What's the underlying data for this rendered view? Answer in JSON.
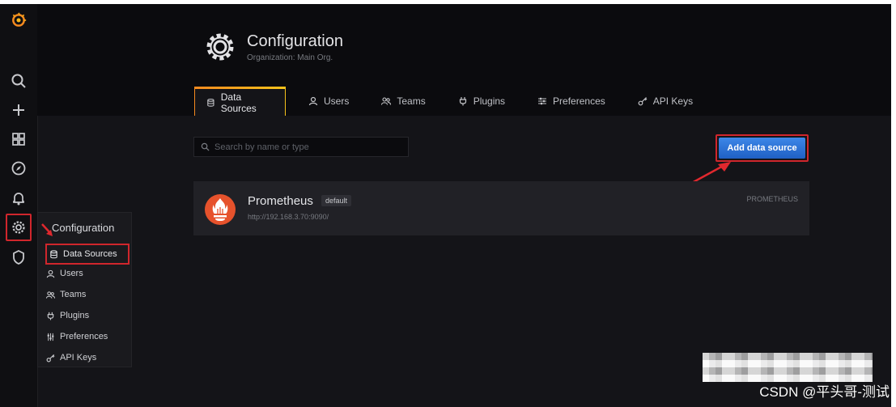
{
  "header": {
    "title": "Configuration",
    "subtitle": "Organization: Main Org."
  },
  "tabs": [
    {
      "label": "Data Sources",
      "icon": "database-icon",
      "active": true
    },
    {
      "label": "Users",
      "icon": "user-icon"
    },
    {
      "label": "Teams",
      "icon": "users-icon"
    },
    {
      "label": "Plugins",
      "icon": "plug-icon"
    },
    {
      "label": "Preferences",
      "icon": "sliders-icon"
    },
    {
      "label": "API Keys",
      "icon": "key-icon"
    }
  ],
  "search": {
    "placeholder": "Search by name or type",
    "value": ""
  },
  "toolbar": {
    "add_label": "Add data source"
  },
  "datasource": {
    "name": "Prometheus",
    "badge": "default",
    "url": "http://192.168.3.70:9090/",
    "type": "PROMETHEUS"
  },
  "flyout": {
    "title": "Configuration",
    "items": [
      {
        "label": "Data Sources",
        "icon": "database-icon"
      },
      {
        "label": "Users",
        "icon": "user-icon"
      },
      {
        "label": "Teams",
        "icon": "users-icon"
      },
      {
        "label": "Plugins",
        "icon": "plug-icon"
      },
      {
        "label": "Preferences",
        "icon": "sliders-icon"
      },
      {
        "label": "API Keys",
        "icon": "key-icon"
      }
    ]
  },
  "sidebar": {
    "icons": [
      "grafana-logo-icon",
      "search-icon",
      "plus-icon",
      "dashboards-icon",
      "compass-icon",
      "bell-icon",
      "gear-icon",
      "shield-icon"
    ]
  },
  "watermark": "CSDN @平头哥-测试",
  "colors": {
    "background": "#141418",
    "primary_button": "#1f60c4",
    "highlight_border": "#d0262c",
    "active_tab_accent": "#f58a1f",
    "prometheus": "#e6522c"
  }
}
